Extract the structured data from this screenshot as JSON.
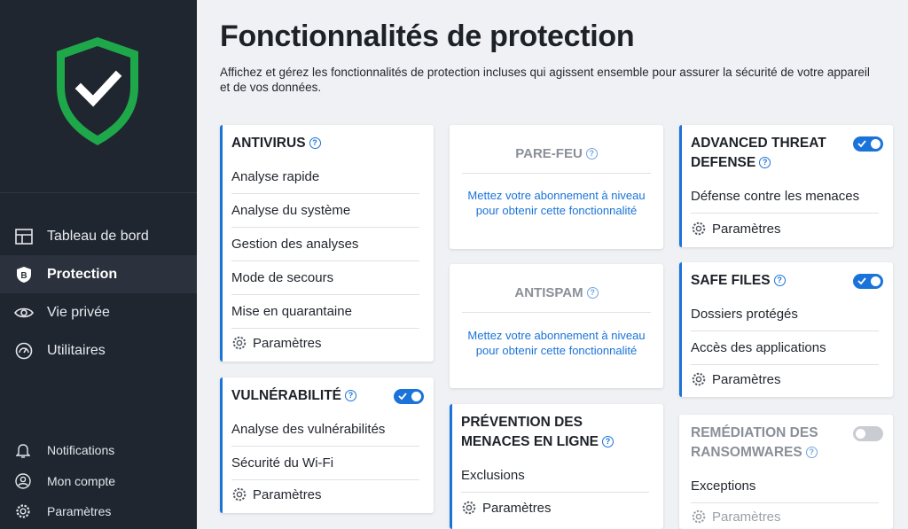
{
  "sidebar": {
    "nav": [
      {
        "label": "Tableau de bord",
        "icon": "dashboard-icon"
      },
      {
        "label": "Protection",
        "icon": "protection-shield-icon",
        "active": true
      },
      {
        "label": "Vie privée",
        "icon": "eye-icon"
      },
      {
        "label": "Utilitaires",
        "icon": "gauge-icon"
      }
    ],
    "bottom": [
      {
        "label": "Notifications",
        "icon": "bell-icon"
      },
      {
        "label": "Mon compte",
        "icon": "account-icon"
      },
      {
        "label": "Paramètres",
        "icon": "gear-icon"
      }
    ]
  },
  "main": {
    "title": "Fonctionnalités de protection",
    "description": "Affichez et gérez les fonctionnalités de protection incluses qui agissent ensemble pour assurer la sécurité de votre appareil et de vos données."
  },
  "cards": {
    "antivirus": {
      "title": "ANTIVIRUS",
      "items": [
        "Analyse rapide",
        "Analyse du système",
        "Gestion des analyses",
        "Mode de secours",
        "Mise en quarantaine"
      ],
      "settings": "Paramètres"
    },
    "vulnerabilite": {
      "title": "VULNÉRABILITÉ",
      "toggle": true,
      "items": [
        "Analyse des vulnérabilités",
        "Sécurité du Wi-Fi"
      ],
      "settings": "Paramètres"
    },
    "parefeu": {
      "title": "PARE-FEU",
      "message": "Mettez votre abonnement à niveau pour obtenir cette fonctionnalité"
    },
    "antispam": {
      "title": "ANTISPAM",
      "message": "Mettez votre abonnement à niveau pour obtenir cette fonctionnalité"
    },
    "prevention": {
      "title_line1": "PRÉVENTION DES",
      "title_line2": "MENACES EN LIGNE",
      "items": [
        "Exclusions"
      ],
      "settings": "Paramètres"
    },
    "atd": {
      "title_line1": "ADVANCED THREAT",
      "title_line2": "DEFENSE",
      "toggle": true,
      "items": [
        "Défense contre les menaces"
      ],
      "settings": "Paramètres"
    },
    "safefiles": {
      "title": "SAFE FILES",
      "toggle": true,
      "items": [
        "Dossiers protégés",
        "Accès des applications"
      ],
      "settings": "Paramètres"
    },
    "ransomware": {
      "title_line1": "REMÉDIATION DES",
      "title_line2": "RANSOMWARES",
      "toggle": false,
      "items": [
        "Exceptions"
      ],
      "settings": "Paramètres"
    }
  },
  "colors": {
    "accent": "#1a73d9",
    "shield_green": "#1fa84a",
    "sidebar_bg": "#1f2630"
  }
}
